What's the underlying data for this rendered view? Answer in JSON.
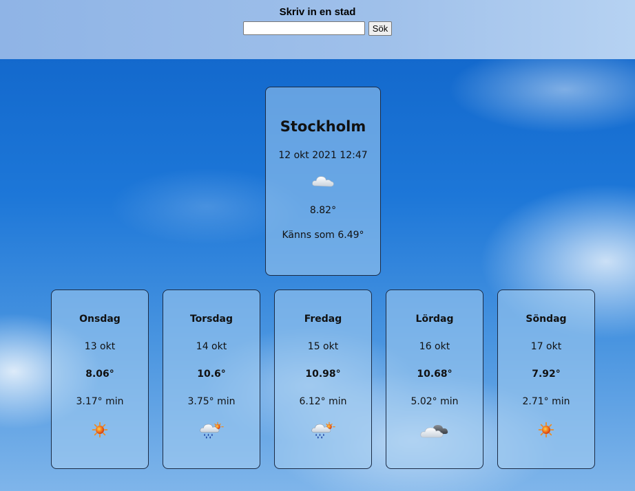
{
  "header": {
    "title": "Skriv in en stad",
    "search_value": "",
    "search_button": "Sök"
  },
  "current": {
    "city": "Stockholm",
    "datetime": "12 okt 2021 12:47",
    "icon": "cloud-icon",
    "temp": "8.82°",
    "feels_like": "Känns som 6.49°"
  },
  "forecast": [
    {
      "day": "Onsdag",
      "date": "13 okt",
      "max": "8.06°",
      "min": "3.17° min",
      "icon": "sun-icon"
    },
    {
      "day": "Torsdag",
      "date": "14 okt",
      "max": "10.6°",
      "min": "3.75° min",
      "icon": "rain-sun-icon"
    },
    {
      "day": "Fredag",
      "date": "15 okt",
      "max": "10.98°",
      "min": "6.12° min",
      "icon": "rain-sun-icon"
    },
    {
      "day": "Lördag",
      "date": "16 okt",
      "max": "10.68°",
      "min": "5.02° min",
      "icon": "clouds-icon"
    },
    {
      "day": "Söndag",
      "date": "17 okt",
      "max": "7.92°",
      "min": "2.71° min",
      "icon": "sun-icon"
    }
  ]
}
